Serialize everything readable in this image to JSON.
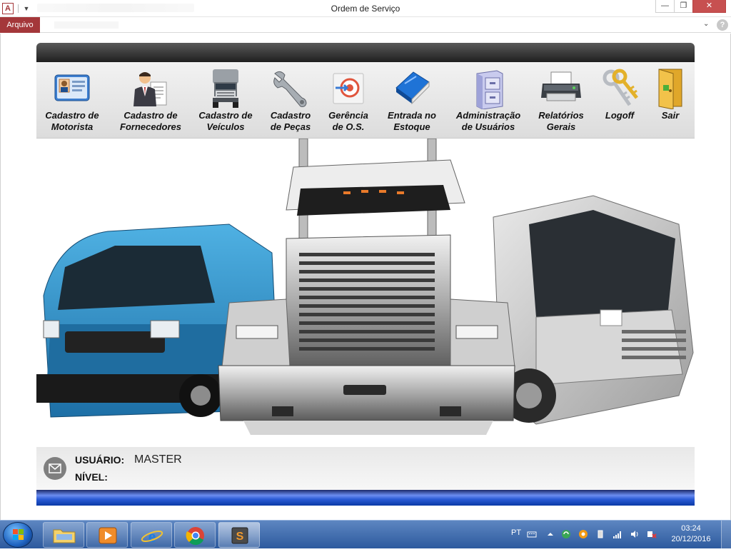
{
  "window": {
    "title": "Ordem de Serviço",
    "app_icon_letter": "A",
    "min_glyph": "—",
    "max_glyph": "❐",
    "close_glyph": "✕"
  },
  "ribbon": {
    "file_tab": "Arquivo",
    "collapse_glyph": "⌄",
    "help_glyph": "?"
  },
  "toolbar": {
    "items": [
      {
        "line1": "Cadastro de",
        "line2": "Motorista",
        "icon": "id-card-icon"
      },
      {
        "line1": "Cadastro de",
        "line2": "Fornecedores",
        "icon": "businessman-icon"
      },
      {
        "line1": "Cadastro de",
        "line2": "Veículos",
        "icon": "truck-icon"
      },
      {
        "line1": "Cadastro",
        "line2": "de Peças",
        "icon": "wrench-icon"
      },
      {
        "line1": "Gerência",
        "line2": "de O.S.",
        "icon": "target-icon"
      },
      {
        "line1": "Entrada no",
        "line2": "Estoque",
        "icon": "book-icon"
      },
      {
        "line1": "Administração",
        "line2": "de Usuários",
        "icon": "filing-cabinet-icon"
      },
      {
        "line1": "Relatórios",
        "line2": "Gerais",
        "icon": "printer-icon"
      },
      {
        "line1": "Logoff",
        "line2": "",
        "icon": "keys-icon"
      },
      {
        "line1": "Sair",
        "line2": "",
        "icon": "door-icon"
      }
    ]
  },
  "info": {
    "user_label": "USUÁRIO:",
    "user_value": "MASTER",
    "level_label": "NÍVEL:",
    "level_value": ""
  },
  "taskbar": {
    "language": "PT",
    "time": "03:24",
    "date": "20/12/2016"
  },
  "colors": {
    "access_accent": "#a4373a",
    "header_dark": "#2b2b2b",
    "bottom_bar_blue": "#2a5bd6",
    "van_blue": "#2b8fc9"
  }
}
